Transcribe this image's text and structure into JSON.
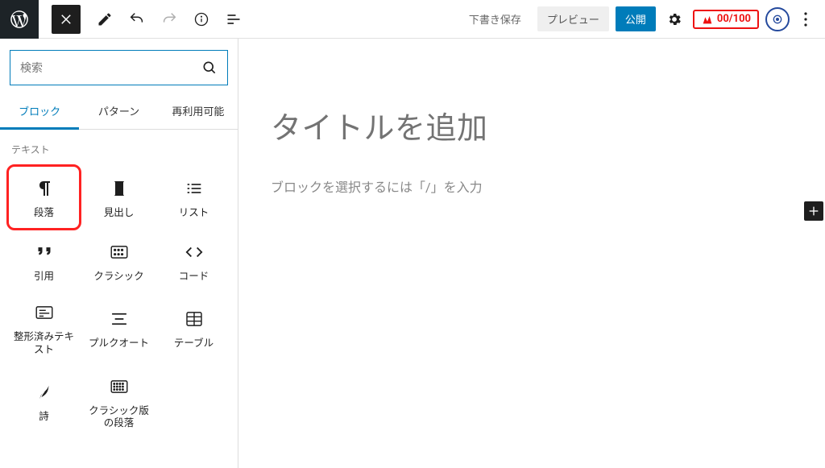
{
  "toolbar": {
    "draft_label": "下書き保存",
    "preview_label": "プレビュー",
    "publish_label": "公開",
    "score_text": "00/100"
  },
  "inserter": {
    "search_placeholder": "検索",
    "tabs": {
      "blocks": "ブロック",
      "patterns": "パターン",
      "reusable": "再利用可能"
    },
    "section_text": "テキスト",
    "items": [
      {
        "label": "段落"
      },
      {
        "label": "見出し"
      },
      {
        "label": "リスト"
      },
      {
        "label": "引用"
      },
      {
        "label": "クラシック"
      },
      {
        "label": "コード"
      },
      {
        "label": "整形済みテキ\nスト"
      },
      {
        "label": "プルクオート"
      },
      {
        "label": "テーブル"
      },
      {
        "label": "詩"
      },
      {
        "label": "クラシック版\nの段落"
      }
    ]
  },
  "canvas": {
    "title_placeholder": "タイトルを追加",
    "block_hint": "ブロックを選択するには「/」を入力"
  }
}
